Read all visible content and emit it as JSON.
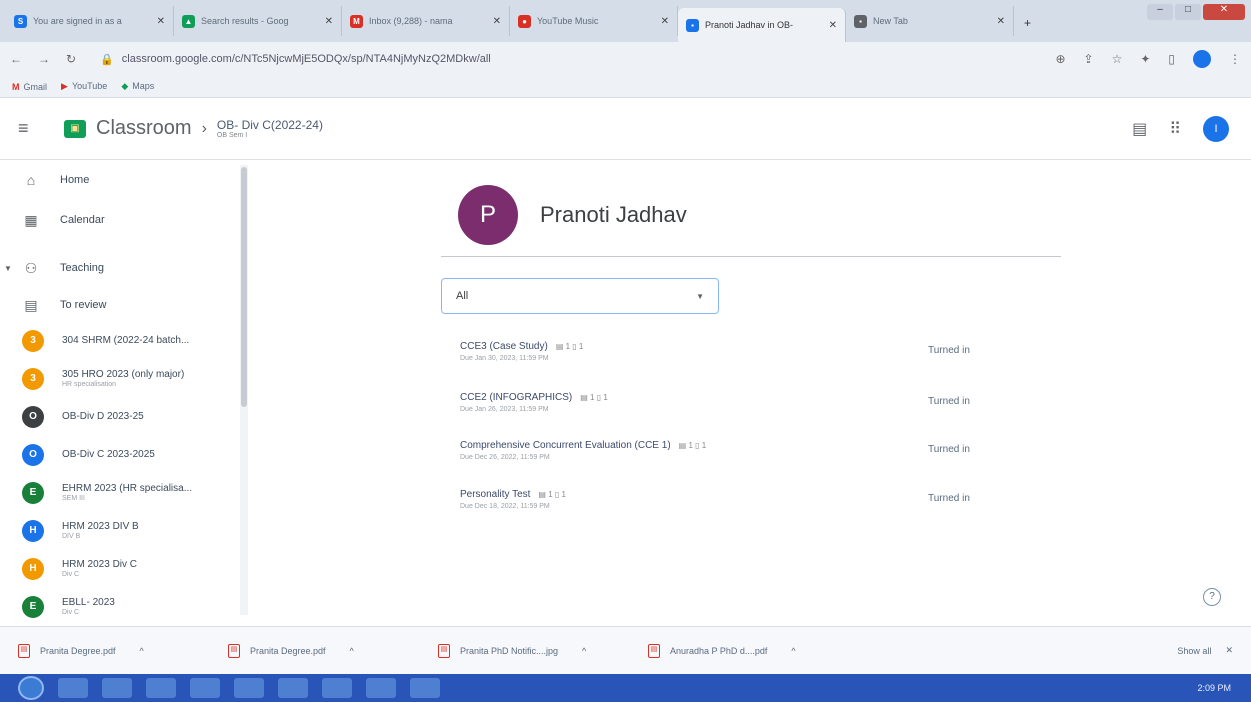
{
  "browser": {
    "tabs": [
      {
        "title": "You are signed in as a",
        "icon": "S",
        "color": "#1a73e8",
        "active": false
      },
      {
        "title": "Search results - Goog",
        "icon": "▲",
        "color": "#0f9d58",
        "active": false
      },
      {
        "title": "Inbox (9,288) - nama",
        "icon": "M",
        "color": "#d93025",
        "active": false
      },
      {
        "title": "YouTube Music",
        "icon": "●",
        "color": "#d93025",
        "active": false
      },
      {
        "title": "Pranoti Jadhav in OB-",
        "icon": "▪",
        "color": "#1a73e8",
        "active": true
      },
      {
        "title": "New Tab",
        "icon": "▪",
        "color": "#5f6368",
        "active": false
      }
    ],
    "url": "classroom.google.com/c/NTc5NjcwMjE5ODQx/sp/NTA4NjMyNzQ2MDkw/all",
    "bookmarks": [
      {
        "label": "Gmail",
        "icon": "M",
        "color": "#d93025"
      },
      {
        "label": "YouTube",
        "icon": "▶",
        "color": "#d93025"
      },
      {
        "label": "Maps",
        "icon": "◆",
        "color": "#0f9d58"
      }
    ]
  },
  "header": {
    "brand": "Classroom",
    "class_name": "OB- Div C(2022-24)",
    "class_section": "OB Sem I",
    "avatar_letter": "I"
  },
  "sidebar": {
    "items": [
      {
        "label": "Home",
        "icon": "⌂"
      },
      {
        "label": "Calendar",
        "icon": "▦"
      }
    ],
    "teaching": {
      "label": "Teaching",
      "icon": "👥"
    },
    "to_review": {
      "label": "To review",
      "icon": "▤"
    },
    "classes": [
      {
        "name": "304 SHRM (2022-24 batch...",
        "sub": "",
        "letter": "3",
        "color": "#f29900"
      },
      {
        "name": "305 HRO 2023 (only major)",
        "sub": "HR specialisation",
        "letter": "3",
        "color": "#f29900"
      },
      {
        "name": "OB-Div D 2023-25",
        "sub": "",
        "letter": "O",
        "color": "#3c4043"
      },
      {
        "name": "OB-Div C 2023-2025",
        "sub": "",
        "letter": "O",
        "color": "#1a73e8"
      },
      {
        "name": "EHRM 2023 (HR specialisa...",
        "sub": "SEM III",
        "letter": "E",
        "color": "#188038"
      },
      {
        "name": "HRM 2023 DIV B",
        "sub": "DIV B",
        "letter": "H",
        "color": "#1a73e8"
      },
      {
        "name": "HRM 2023 Div C",
        "sub": "Div C",
        "letter": "H",
        "color": "#f29900"
      },
      {
        "name": "EBLL- 2023",
        "sub": "Div C",
        "letter": "E",
        "color": "#188038"
      }
    ]
  },
  "student": {
    "name": "Pranoti Jadhav",
    "initial": "P"
  },
  "filter": {
    "value": "All"
  },
  "assignments": [
    {
      "title": "CCE3 (Case Study)",
      "meta": "▤ 1  ▯ 1",
      "due": "Due Jan 30, 2023, 11:59 PM",
      "status": "Turned in"
    },
    {
      "title": "CCE2 (INFOGRAPHICS)",
      "meta": "▤ 1  ▯ 1",
      "due": "Due Jan 26, 2023, 11:59 PM",
      "status": "Turned in"
    },
    {
      "title": "Comprehensive Concurrent Evaluation (CCE 1)",
      "meta": "▤ 1  ▯ 1",
      "due": "Due Dec 26, 2022, 11:59 PM",
      "status": "Turned in"
    },
    {
      "title": "Personality Test",
      "meta": "▤ 1  ▯ 1",
      "due": "Due Dec 18, 2022, 11:59 PM",
      "status": "Turned in"
    }
  ],
  "downloads": [
    {
      "name": "Pranita Degree.pdf"
    },
    {
      "name": "Pranita Degree.pdf"
    },
    {
      "name": "Pranita PhD Notific....jpg"
    },
    {
      "name": "Anuradha P PhD d....pdf"
    }
  ],
  "downloads_show_all": "Show all",
  "taskbar": {
    "clock": "2:09 PM"
  }
}
